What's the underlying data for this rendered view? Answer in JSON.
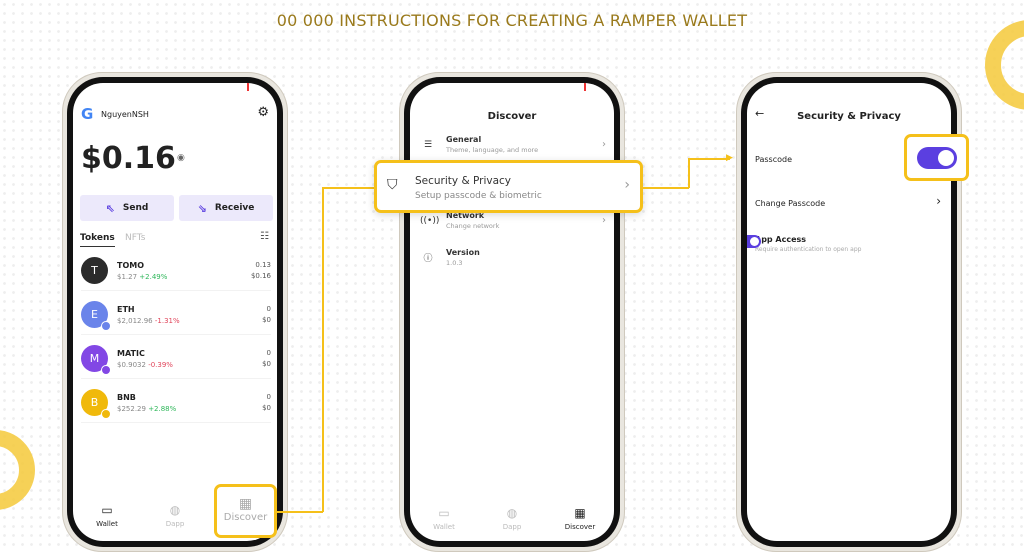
{
  "page_title": "00 000 INSTRUCTIONS FOR CREATING A RAMPER WALLET",
  "colors": {
    "accent": "#5b3fe0",
    "highlight": "#f5c01a",
    "title": "#9a7a1c",
    "positive": "#2fb75a",
    "negative": "#e0445a"
  },
  "wallet": {
    "user": "NguyenNSH",
    "balance": "$0.16",
    "send": "Send",
    "receive": "Receive",
    "tabs": [
      "Tokens",
      "NFTs"
    ],
    "tokens": [
      {
        "symbol": "TOMO",
        "price": "$1.27",
        "change": "+2.49%",
        "amount": "0.13",
        "value": "$0.16",
        "color": "#2b2b2b"
      },
      {
        "symbol": "ETH",
        "price": "$2,012.96",
        "change": "-1.31%",
        "amount": "0",
        "value": "$0",
        "color": "#6a84ea"
      },
      {
        "symbol": "MATIC",
        "price": "$0.9032",
        "change": "-0.39%",
        "amount": "0",
        "value": "$0",
        "color": "#8247e5"
      },
      {
        "symbol": "BNB",
        "price": "$252.29",
        "change": "+2.88%",
        "amount": "0",
        "value": "$0",
        "color": "#f0b90b"
      }
    ],
    "nav": [
      "Wallet",
      "Dapp",
      "Discover"
    ]
  },
  "discover": {
    "title": "Discover",
    "items": [
      {
        "title": "General",
        "subtitle": "Theme, language, and more"
      },
      {
        "title": "Security & Privacy",
        "subtitle": "Setup passcode & biometric"
      },
      {
        "title": "Network",
        "subtitle": "Change network"
      },
      {
        "title": "Version",
        "subtitle": "1.0.3"
      }
    ],
    "nav": [
      "Wallet",
      "Dapp",
      "Discover"
    ]
  },
  "security": {
    "title": "Security & Privacy",
    "passcode": "Passcode",
    "passcode_on": true,
    "change_passcode": "Change Passcode",
    "app_access": "App Access",
    "app_access_sub": "Require authentication to open app",
    "app_access_on": true
  }
}
